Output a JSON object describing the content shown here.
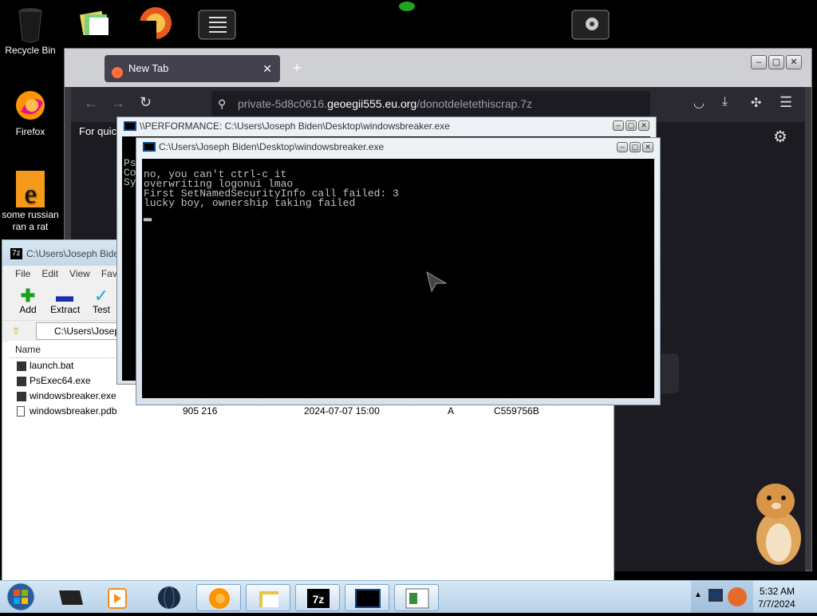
{
  "desktop": {
    "icons": [
      {
        "label": "Recycle Bin"
      },
      {
        "label": "Firefox"
      },
      {
        "label": "some russian ran a rat"
      }
    ]
  },
  "firefox": {
    "tab_title": "New Tab",
    "new_tab": "+",
    "url_host": "private-5d8c0616.",
    "url_domain": "geoegii555.eu.org",
    "url_path": "/donotdeletethiscrap.7z",
    "quick_text": "For quick"
  },
  "sevenzip": {
    "title": "C:\\Users\\Joseph Bide",
    "menu": [
      "File",
      "Edit",
      "View",
      "Favo"
    ],
    "tools": [
      "Add",
      "Extract",
      "Test"
    ],
    "path": "C:\\Users\\Josep",
    "column_name": "Name",
    "files": [
      {
        "name": "launch.bat",
        "size": "",
        "modified": "",
        "attr": "",
        "crc": ""
      },
      {
        "name": "PsExec64.exe",
        "size": "",
        "modified": "",
        "attr": "",
        "crc": ""
      },
      {
        "name": "windowsbreaker.exe",
        "size": "",
        "modified": "",
        "attr": "",
        "crc": ""
      },
      {
        "name": "windowsbreaker.pdb",
        "size": "905 216",
        "modified": "2024-07-07 15:00",
        "attr": "A",
        "crc": "C559756B"
      }
    ]
  },
  "console_back": {
    "title": "\\\\PERFORMANCE: C:\\Users\\Joseph Biden\\Desktop\\windowsbreaker.exe",
    "lines": [
      "Ps",
      "Co",
      "Sy"
    ]
  },
  "console_front": {
    "title": "C:\\Users\\Joseph Biden\\Desktop\\windowsbreaker.exe",
    "lines": [
      "no, you can't ctrl-c it",
      "overwriting logonui lmao",
      "First SetNamedSecurityInfo call failed: 3",
      "lucky boy, ownership taking failed"
    ]
  },
  "clock": {
    "time": "5:32 AM",
    "date": "7/7/2024"
  },
  "colors": {
    "accent": "#0060df",
    "taskbar": "#c9dcee"
  }
}
